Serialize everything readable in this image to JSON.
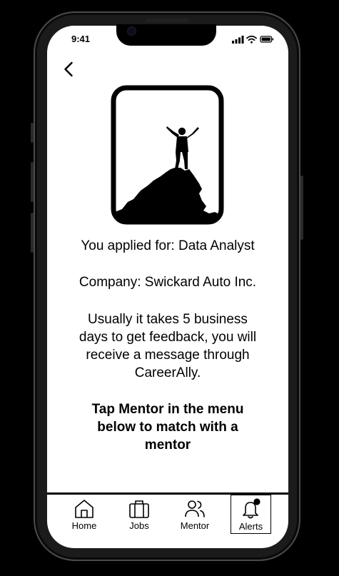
{
  "status_bar": {
    "time": "9:41"
  },
  "content": {
    "applied_line": "You applied for: Data Analyst",
    "company_line": "Company: Swickard Auto Inc.",
    "info_lines": [
      "Usually it takes 5 business",
      "days to get feedback, you will",
      "receive a message  through",
      "CareerAlly."
    ],
    "cta_lines": [
      "Tap Mentor in the menu",
      "below to match with a",
      "mentor"
    ]
  },
  "nav": {
    "items": [
      {
        "label": "Home",
        "icon": "home-icon"
      },
      {
        "label": "Jobs",
        "icon": "briefcase-icon"
      },
      {
        "label": "Mentor",
        "icon": "people-icon"
      },
      {
        "label": "Alerts",
        "icon": "bell-icon",
        "active": true
      }
    ]
  }
}
